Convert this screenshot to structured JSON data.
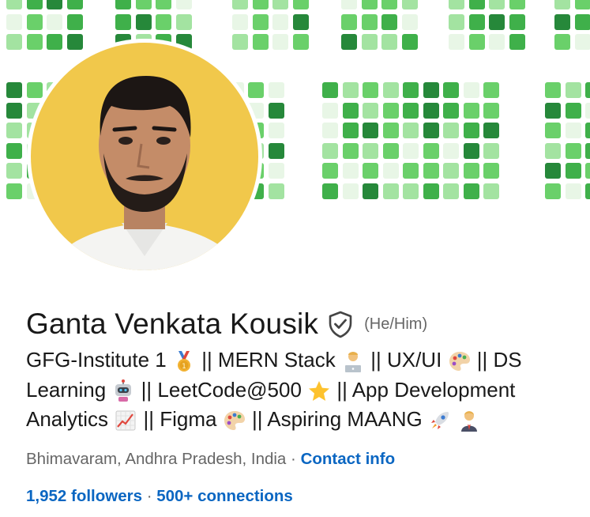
{
  "profile": {
    "name": "Ganta Venkata Kousik",
    "verified_icon": "shield-check-icon",
    "pronouns": "(He/Him)",
    "headline": {
      "line1": {
        "a": "GFG-Institute 1",
        "b": "|| MERN Stack",
        "c": "|| UX/UI",
        "d": "|| DS"
      },
      "line2": {
        "a": "Learning",
        "b": "|| LeetCode@500",
        "c": "|| App Development"
      },
      "line3": {
        "a": "Analytics",
        "b": "|| Figma",
        "c": "|| Aspiring MAANG"
      }
    },
    "icons": [
      "medal-icon",
      "technologist-icon",
      "palette-icon",
      "robot-icon",
      "star-icon",
      "chart-icon",
      "palette-icon",
      "rocket-icon",
      "office-worker-icon"
    ],
    "location": "Bhimavaram, Andhra Pradesh, India",
    "separator": "·",
    "contact_info": "Contact info",
    "followers": "1,952 followers",
    "connections": "500+ connections"
  },
  "colors": {
    "name": "#191919",
    "secondary_text": "#666666",
    "link": "#0a66c2",
    "avatar_bg": "#f1c84b",
    "banner_greens": [
      "#e8f6e6",
      "#a3e3a1",
      "#6ad06a",
      "#3fb04a",
      "#26883a"
    ]
  }
}
